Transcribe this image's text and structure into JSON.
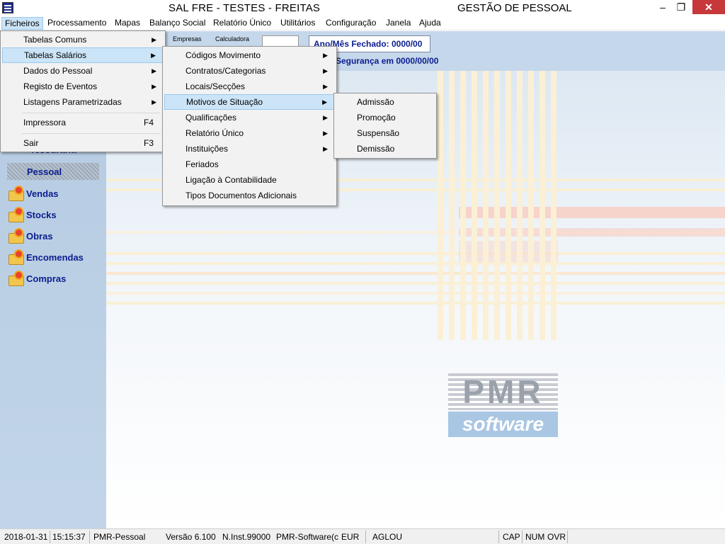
{
  "window": {
    "title_left": "SAL FRE - TESTES - FREITAS",
    "title_right": "GESTÃO DE PESSOAL",
    "minimize": "–",
    "maximize": "❐",
    "close": "✕"
  },
  "menubar": [
    "Ficheiros",
    "Processamento",
    "Mapas",
    "Balanço Social",
    "Relatório Único",
    "Utilitários",
    "Configuração",
    "Janela",
    "Ajuda"
  ],
  "header": {
    "empresas": "Empresas",
    "calculadora": "Calculadora",
    "fechado": "Ano/Mês Fechado: 0000/00",
    "seguranca": "Segurança em  0000/00/00"
  },
  "sidebar": {
    "partial_item": "Tesouraria",
    "selected_item": "Pessoal",
    "items": [
      "Vendas",
      "Stocks",
      "Obras",
      "Encomendas",
      "Compras"
    ]
  },
  "menu_ficheiros": {
    "items": [
      {
        "label": "Tabelas  Comuns"
      },
      {
        "label": "Tabelas Salários"
      },
      {
        "label": "Dados do  Pessoal"
      },
      {
        "label": "Registo de Eventos"
      },
      {
        "label": "Listagens Parametrizadas"
      }
    ],
    "impressora": {
      "label": "Impressora",
      "shortcut": "F4"
    },
    "sair": {
      "label": "Sair",
      "shortcut": "F3"
    }
  },
  "menu_tabelas_salarios": {
    "items": [
      {
        "label": "Códigos  Movimento"
      },
      {
        "label": "Contratos/Categorias"
      },
      {
        "label": "Locais/Secções"
      },
      {
        "label": "Motivos de Situação"
      },
      {
        "label": "Qualificações"
      },
      {
        "label": "Relatório Único"
      },
      {
        "label": "Instituições"
      },
      {
        "label": "Feriados"
      },
      {
        "label": "Ligação à Contabilidade"
      },
      {
        "label": "Tipos Documentos Adicionais"
      }
    ]
  },
  "menu_motivos": {
    "items": [
      "Admissão",
      "Promoção",
      "Suspensão",
      "Demissão"
    ]
  },
  "logo": {
    "top": "PMR",
    "bottom": "software"
  },
  "statusbar": {
    "date": "2018-01-31",
    "time": "15:15:37",
    "module": "PMR-Pessoal",
    "version": "Versão  6.100",
    "inst": "N.Inst.99000",
    "owner": "PMR-Software(c",
    "currency": "EUR",
    "user": "AGLOU",
    "cap": "CAP",
    "num": "NUM",
    "ovr": "OVR"
  },
  "colors": {
    "menu_highlight": "#cce4f7",
    "accent_text": "#0b1d8f",
    "close_button": "#c7383a",
    "sidebar": "#b4cae1"
  }
}
